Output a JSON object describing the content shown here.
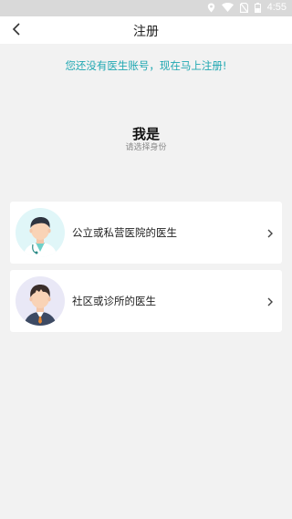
{
  "status_bar": {
    "time": "4:55"
  },
  "header": {
    "title": "注册"
  },
  "notice": "您还没有医生账号，现在马上注册!",
  "identity": {
    "title": "我是",
    "subtitle": "请选择身份"
  },
  "options": [
    {
      "label": "公立或私营医院的医生"
    },
    {
      "label": "社区或诊所的医生"
    }
  ],
  "colors": {
    "accent": "#20a8b2",
    "background": "#f2f2f2"
  }
}
